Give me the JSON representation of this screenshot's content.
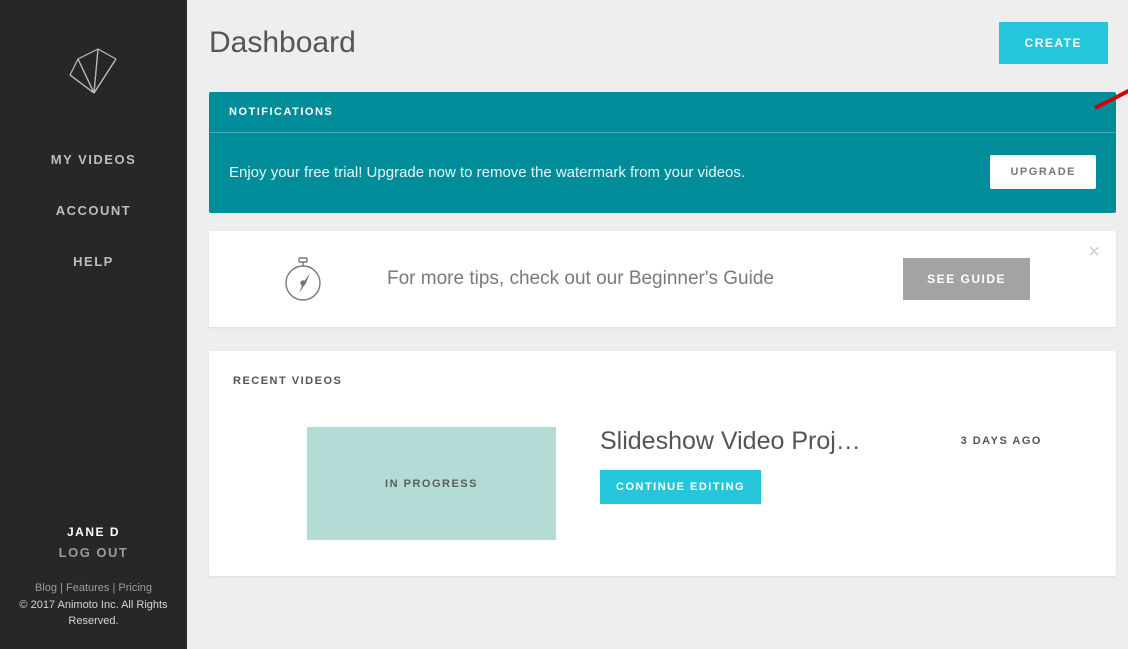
{
  "sidebar": {
    "nav": [
      "MY VIDEOS",
      "ACCOUNT",
      "HELP"
    ],
    "user_name": "JANE D",
    "logout_label": "LOG OUT",
    "footer_links": [
      "Blog",
      "Features",
      "Pricing"
    ],
    "copyright": "© 2017 Animoto Inc. All Rights Reserved."
  },
  "header": {
    "title": "Dashboard",
    "create_label": "CREATE"
  },
  "notifications": {
    "heading": "NOTIFICATIONS",
    "message": "Enjoy your free trial! Upgrade now to remove the watermark from your videos.",
    "upgrade_label": "UPGRADE"
  },
  "tips": {
    "message": "For more tips, check out our Beginner's Guide",
    "see_guide_label": "SEE GUIDE"
  },
  "recent": {
    "heading": "RECENT VIDEOS",
    "thumb_status": "IN PROGRESS",
    "video_title": "Slideshow Video Proj…",
    "continue_label": "CONTINUE EDITING",
    "timestamp": "3 DAYS AGO"
  }
}
